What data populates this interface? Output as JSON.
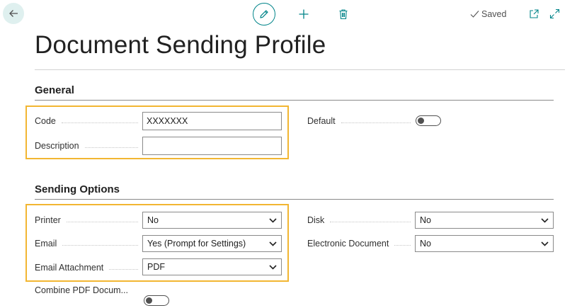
{
  "toolbar": {
    "saved_label": "Saved",
    "accent_color": "#008489",
    "icons": [
      "back-arrow-icon",
      "pencil-icon",
      "plus-icon",
      "trash-icon",
      "checkmark-icon",
      "open-in-new-window-icon",
      "expand-icon"
    ]
  },
  "page": {
    "title": "Document Sending Profile"
  },
  "general": {
    "title": "General",
    "code_label": "Code",
    "code_value": "XXXXXXX",
    "description_label": "Description",
    "description_value": "",
    "default_label": "Default",
    "default_on": false
  },
  "sending": {
    "title": "Sending Options",
    "printer_label": "Printer",
    "printer_value": "No",
    "email_label": "Email",
    "email_value": "Yes (Prompt for Settings)",
    "attachment_label": "Email Attachment",
    "attachment_value": "PDF",
    "combine_label": "Combine PDF Docum...",
    "combine_on": false,
    "disk_label": "Disk",
    "disk_value": "No",
    "edoc_label": "Electronic Document",
    "edoc_value": "No"
  },
  "highlight_color": "#f2b632"
}
